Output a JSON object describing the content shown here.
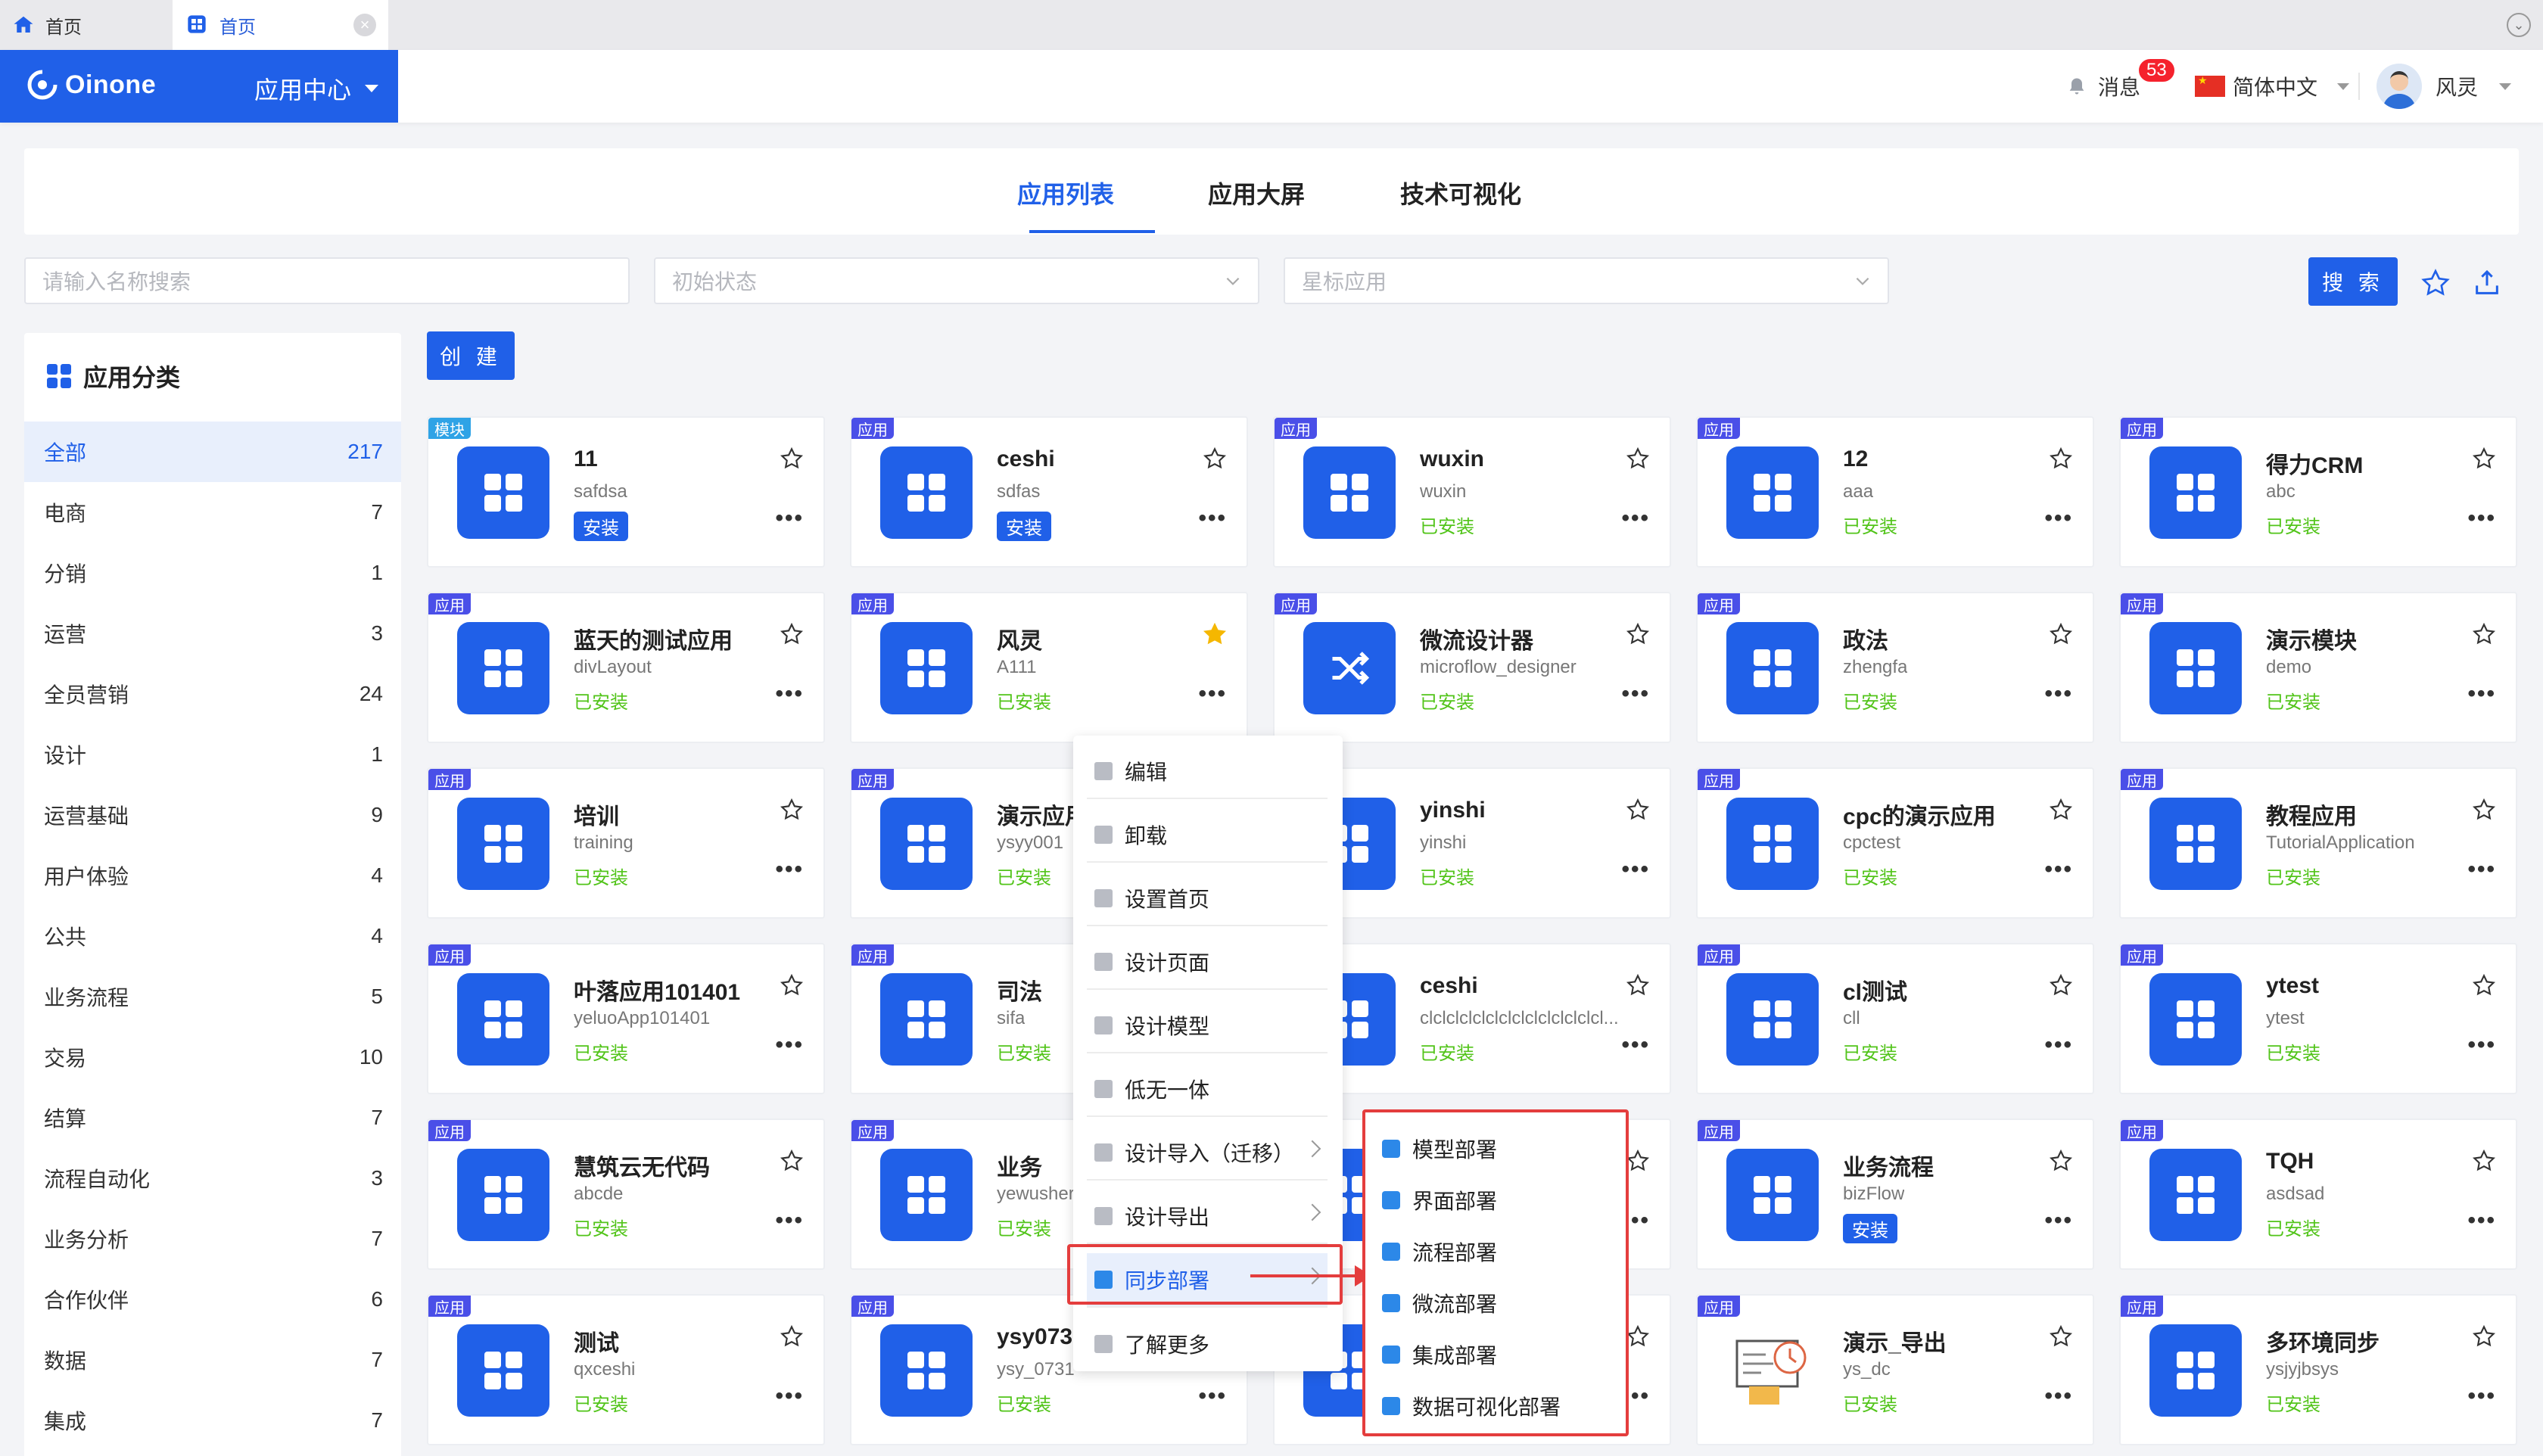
{
  "browser_tabs": [
    {
      "label": "首页"
    },
    {
      "label": "首页"
    }
  ],
  "header": {
    "brand": "Oinone",
    "app_center": "应用中心",
    "messages": "消息",
    "message_count": "53",
    "language": "简体中文",
    "user": "风灵"
  },
  "top_tabs": [
    "应用列表",
    "应用大屏",
    "技术可视化"
  ],
  "filters": {
    "search_placeholder": "请输入名称搜索",
    "status_placeholder": "初始状态",
    "star_placeholder": "星标应用",
    "search_button": "搜 索"
  },
  "sidebar": {
    "title": "应用分类",
    "items": [
      {
        "label": "全部",
        "count": "217"
      },
      {
        "label": "电商",
        "count": "7"
      },
      {
        "label": "分销",
        "count": "1"
      },
      {
        "label": "运营",
        "count": "3"
      },
      {
        "label": "全员营销",
        "count": "24"
      },
      {
        "label": "设计",
        "count": "1"
      },
      {
        "label": "运营基础",
        "count": "9"
      },
      {
        "label": "用户体验",
        "count": "4"
      },
      {
        "label": "公共",
        "count": "4"
      },
      {
        "label": "业务流程",
        "count": "5"
      },
      {
        "label": "交易",
        "count": "10"
      },
      {
        "label": "结算",
        "count": "7"
      },
      {
        "label": "流程自动化",
        "count": "3"
      },
      {
        "label": "业务分析",
        "count": "7"
      },
      {
        "label": "合作伙伴",
        "count": "6"
      },
      {
        "label": "数据",
        "count": "7"
      },
      {
        "label": "集成",
        "count": "7"
      }
    ]
  },
  "create_button": "创 建",
  "apps": [
    {
      "tag": "模块",
      "name": "11",
      "code": "safdsa",
      "status": "安装",
      "status_btn": true,
      "star": false,
      "icon": "grid"
    },
    {
      "tag": "应用",
      "name": "ceshi",
      "code": "sdfas",
      "status": "安装",
      "status_btn": true,
      "star": false,
      "icon": "grid"
    },
    {
      "tag": "应用",
      "name": "wuxin",
      "code": "wuxin",
      "status": "已安装",
      "star": false,
      "icon": "grid"
    },
    {
      "tag": "应用",
      "name": "12",
      "code": "aaa",
      "status": "已安装",
      "star": false,
      "icon": "grid"
    },
    {
      "tag": "应用",
      "name": "得力CRM",
      "code": "abc",
      "status": "已安装",
      "star": false,
      "icon": "grid"
    },
    {
      "tag": "应用",
      "name": "蓝天的测试应用",
      "code": "divLayout",
      "status": "已安装",
      "star": false,
      "icon": "grid"
    },
    {
      "tag": "应用",
      "name": "风灵",
      "code": "A111",
      "status": "已安装",
      "star": true,
      "icon": "grid"
    },
    {
      "tag": "应用",
      "name": "微流设计器",
      "code": "microflow_designer",
      "status": "已安装",
      "star": false,
      "icon": "shuffle"
    },
    {
      "tag": "应用",
      "name": "政法",
      "code": "zhengfa",
      "status": "已安装",
      "star": false,
      "icon": "grid"
    },
    {
      "tag": "应用",
      "name": "演示模块",
      "code": "demo",
      "status": "已安装",
      "star": false,
      "icon": "grid"
    },
    {
      "tag": "应用",
      "name": "培训",
      "code": "training",
      "status": "已安装",
      "star": false,
      "icon": "grid"
    },
    {
      "tag": "应用",
      "name": "演示应用",
      "code": "ysyy001",
      "status": "已安装",
      "star": false,
      "icon": "grid"
    },
    {
      "tag": "应用",
      "name": "yinshi",
      "code": "yinshi",
      "status": "已安装",
      "star": false,
      "icon": "grid"
    },
    {
      "tag": "应用",
      "name": "cpc的演示应用",
      "code": "cpctest",
      "status": "已安装",
      "star": false,
      "icon": "grid"
    },
    {
      "tag": "应用",
      "name": "教程应用",
      "code": "TutorialApplication",
      "status": "已安装",
      "star": false,
      "icon": "grid"
    },
    {
      "tag": "应用",
      "name": "叶落应用101401",
      "code": "yeluoApp101401",
      "status": "已安装",
      "star": false,
      "icon": "grid"
    },
    {
      "tag": "应用",
      "name": "司法",
      "code": "sifa",
      "status": "已安装",
      "star": false,
      "icon": "grid"
    },
    {
      "tag": "应用",
      "name": "ceshi",
      "code": "clclclclclclclclclclclclclcl...",
      "status": "已安装",
      "star": false,
      "icon": "grid"
    },
    {
      "tag": "应用",
      "name": "cl测试",
      "code": "cll",
      "status": "已安装",
      "star": false,
      "icon": "grid"
    },
    {
      "tag": "应用",
      "name": "ytest",
      "code": "ytest",
      "status": "已安装",
      "star": false,
      "icon": "grid"
    },
    {
      "tag": "应用",
      "name": "慧筑云无代码",
      "code": "abcde",
      "status": "已安装",
      "star": false,
      "icon": "grid"
    },
    {
      "tag": "应用",
      "name": "业务",
      "code": "yewusher",
      "status": "已安装",
      "star": false,
      "icon": "grid"
    },
    {
      "tag": "应用",
      "name": "",
      "code": "",
      "status": "",
      "star": false,
      "icon": "grid"
    },
    {
      "tag": "应用",
      "name": "业务流程",
      "code": "bizFlow",
      "status": "安装",
      "status_btn": true,
      "star": false,
      "icon": "grid"
    },
    {
      "tag": "应用",
      "name": "TQH",
      "code": "asdsad",
      "status": "已安装",
      "star": false,
      "icon": "grid"
    },
    {
      "tag": "应用",
      "name": "测试",
      "code": "qxceshi",
      "status": "已安装",
      "star": false,
      "icon": "grid"
    },
    {
      "tag": "应用",
      "name": "ysy0731",
      "code": "ysy_0731",
      "status": "已安装",
      "star": false,
      "icon": "grid"
    },
    {
      "tag": "应用",
      "name": "",
      "code": "",
      "status": "",
      "star": false,
      "icon": "grid"
    },
    {
      "tag": "应用",
      "name": "演示_导出",
      "code": "ys_dc",
      "status": "已安装",
      "star": false,
      "icon": "illustration"
    },
    {
      "tag": "应用",
      "name": "多环境同步",
      "code": "ysjyjbsys",
      "status": "已安装",
      "star": false,
      "icon": "grid"
    }
  ],
  "context_menu": [
    {
      "label": "编辑"
    },
    {
      "label": "卸载"
    },
    {
      "label": "设置首页"
    },
    {
      "label": "设计页面"
    },
    {
      "label": "设计模型"
    },
    {
      "label": "低无一体"
    },
    {
      "label": "设计导入（迁移）",
      "has_sub": true
    },
    {
      "label": "设计导出",
      "has_sub": true
    },
    {
      "label": "同步部署",
      "has_sub": true,
      "active": true
    },
    {
      "label": "了解更多"
    }
  ],
  "sync_submenu": [
    {
      "label": "模型部署"
    },
    {
      "label": "界面部署"
    },
    {
      "label": "流程部署"
    },
    {
      "label": "微流部署"
    },
    {
      "label": "集成部署"
    },
    {
      "label": "数据可视化部署"
    }
  ],
  "colors": {
    "primary": "#2060e8",
    "installed": "#52c41a",
    "highlight": "#e43d3d",
    "star": "#f5b700"
  }
}
